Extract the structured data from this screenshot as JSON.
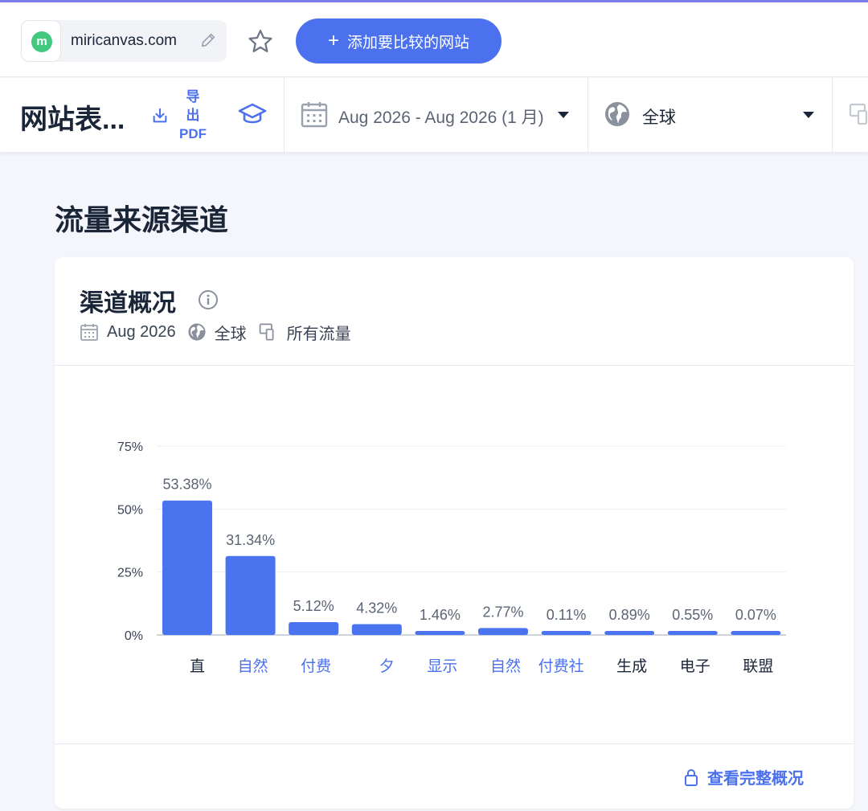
{
  "topbar": {
    "site_logo_letter": "m",
    "site_name": "miricanvas.com",
    "add_compare_label": "添加要比较的网站",
    "add_compare_plus": "+"
  },
  "subbar": {
    "report_title": "网站表...",
    "export_label_line1": "导",
    "export_label_line2": "出",
    "export_label_line3": "PDF",
    "date_range": "Aug 2026 - Aug 2026 (1 月)",
    "region": "全球"
  },
  "section": {
    "title": "流量来源渠道"
  },
  "card": {
    "title": "渠道概况",
    "meta_date": "Aug 2026",
    "meta_region": "全球",
    "meta_traffic": "所有流量",
    "full_overview_label": "查看完整概况"
  },
  "colors": {
    "accent": "#4b71ee",
    "bar": "#4a73f0",
    "top_accent": "#7b7de8"
  },
  "chart_data": {
    "type": "bar",
    "categories": [
      "直",
      "自然",
      "付费",
      "夕",
      "显示",
      "自然",
      "付费社",
      "生成",
      "电子",
      "联盟"
    ],
    "category_label_colors": [
      "#1b2538",
      "#4b71ee",
      "#4b71ee",
      "#4b71ee",
      "#4b71ee",
      "#4b71ee",
      "#4b71ee",
      "#1b2538",
      "#1b2538",
      "#1b2538"
    ],
    "values": [
      53.38,
      31.34,
      5.12,
      4.32,
      1.46,
      2.77,
      0.11,
      0.89,
      0.55,
      0.07
    ],
    "value_labels": [
      "53.38%",
      "31.34%",
      "5.12%",
      "4.32%",
      "1.46%",
      "2.77%",
      "0.11%",
      "0.89%",
      "0.55%",
      "0.07%"
    ],
    "ylim": [
      0,
      75
    ],
    "yticks": [
      0,
      25,
      50,
      75
    ],
    "ytick_labels": [
      "0%",
      "25%",
      "50%",
      "75%"
    ],
    "grid": true
  }
}
